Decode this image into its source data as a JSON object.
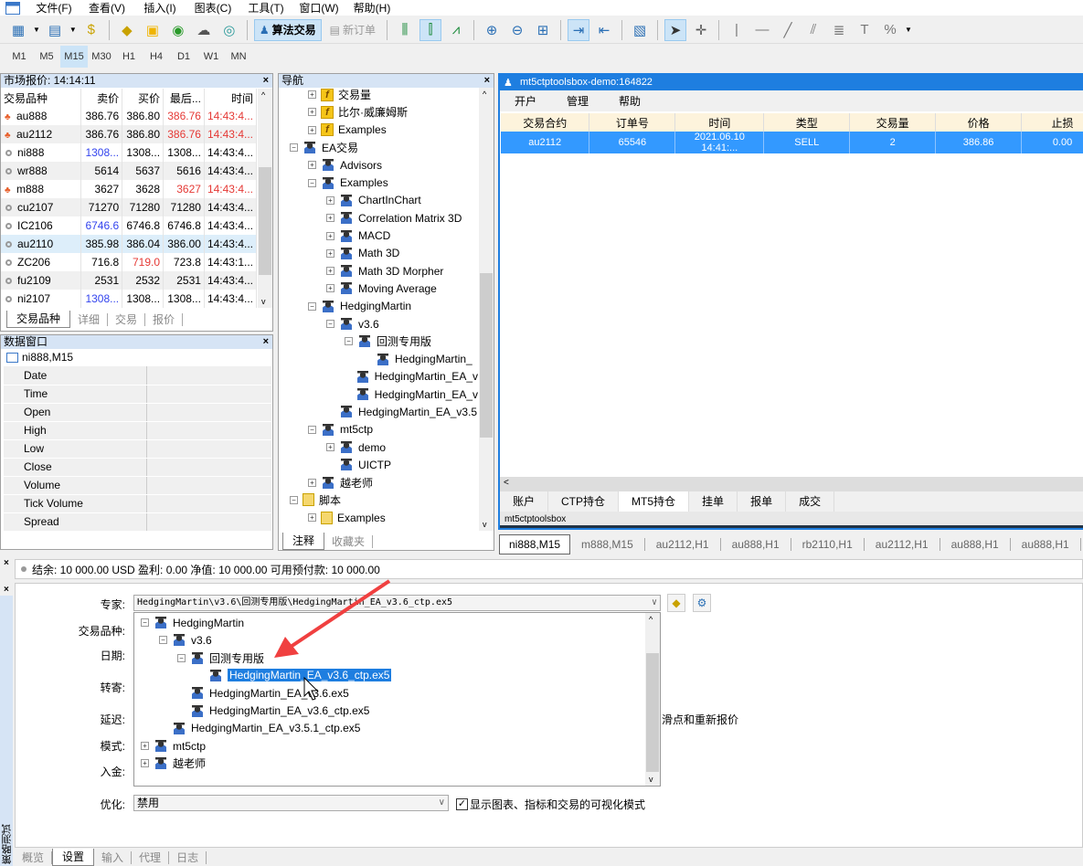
{
  "menu": [
    "文件(F)",
    "查看(V)",
    "插入(I)",
    "图表(C)",
    "工具(T)",
    "窗口(W)",
    "帮助(H)"
  ],
  "toolbar": {
    "algo_trading": "算法交易",
    "new_order": "新订单"
  },
  "timeframes": [
    "M1",
    "M5",
    "M15",
    "M30",
    "H1",
    "H4",
    "D1",
    "W1",
    "MN"
  ],
  "active_timeframe": "M15",
  "market_watch": {
    "title": "市场报价: 14:14:11",
    "columns": [
      "交易品种",
      "卖价",
      "买价",
      "最后...",
      "时间"
    ],
    "rows": [
      {
        "symbol": "au888",
        "bid": "386.76",
        "ask": "386.80",
        "last": "386.76",
        "time": "14:43:4...",
        "icon": "up",
        "last_color": "red"
      },
      {
        "symbol": "au2112",
        "bid": "386.76",
        "ask": "386.80",
        "last": "386.76",
        "time": "14:43:4...",
        "icon": "up",
        "last_color": "red"
      },
      {
        "symbol": "ni888",
        "bid": "1308...",
        "ask": "1308...",
        "last": "1308...",
        "time": "14:43:4...",
        "icon": "dot",
        "bid_color": "blue"
      },
      {
        "symbol": "wr888",
        "bid": "5614",
        "ask": "5637",
        "last": "5616",
        "time": "14:43:4...",
        "icon": "dot"
      },
      {
        "symbol": "m888",
        "bid": "3627",
        "ask": "3628",
        "last": "3627",
        "time": "14:43:4...",
        "icon": "up",
        "last_color": "red"
      },
      {
        "symbol": "cu2107",
        "bid": "71270",
        "ask": "71280",
        "last": "71280",
        "time": "14:43:4...",
        "icon": "dot"
      },
      {
        "symbol": "IC2106",
        "bid": "6746.6",
        "ask": "6746.8",
        "last": "6746.8",
        "time": "14:43:4...",
        "icon": "dot",
        "bid_color": "blue"
      },
      {
        "symbol": "au2110",
        "bid": "385.98",
        "ask": "386.04",
        "last": "386.00",
        "time": "14:43:4...",
        "icon": "dot",
        "selected": true
      },
      {
        "symbol": "ZC206",
        "bid": "716.8",
        "ask": "719.0",
        "last": "723.8",
        "time": "14:43:1...",
        "icon": "dot",
        "ask_color": "red"
      },
      {
        "symbol": "fu2109",
        "bid": "2531",
        "ask": "2532",
        "last": "2531",
        "time": "14:43:4...",
        "icon": "dot"
      },
      {
        "symbol": "ni2107",
        "bid": "1308...",
        "ask": "1308...",
        "last": "1308...",
        "time": "14:43:4...",
        "icon": "dot",
        "bid_color": "blue"
      }
    ],
    "tabs": [
      "交易品种",
      "详细",
      "交易",
      "报价"
    ]
  },
  "data_window": {
    "title": "数据窗口",
    "symbol": "ni888,M15",
    "fields": [
      "Date",
      "Time",
      "Open",
      "High",
      "Low",
      "Close",
      "Volume",
      "Tick Volume",
      "Spread"
    ]
  },
  "navigator": {
    "title": "导航",
    "items": [
      {
        "label": "交易量",
        "level": 2,
        "icon": "indicator",
        "exp": "+"
      },
      {
        "label": "比尔·威廉姆斯",
        "level": 2,
        "icon": "indicator",
        "exp": "+"
      },
      {
        "label": "Examples",
        "level": 2,
        "icon": "indicator-folder",
        "exp": "+"
      },
      {
        "label": "EA交易",
        "level": 1,
        "icon": "ea",
        "exp": "-"
      },
      {
        "label": "Advisors",
        "level": 2,
        "icon": "ea",
        "exp": "+"
      },
      {
        "label": "Examples",
        "level": 2,
        "icon": "ea",
        "exp": "-"
      },
      {
        "label": "ChartInChart",
        "level": 3,
        "icon": "ea",
        "exp": "+"
      },
      {
        "label": "Correlation Matrix 3D",
        "level": 3,
        "icon": "ea",
        "exp": "+"
      },
      {
        "label": "MACD",
        "level": 3,
        "icon": "ea",
        "exp": "+"
      },
      {
        "label": "Math 3D",
        "level": 3,
        "icon": "ea",
        "exp": "+"
      },
      {
        "label": "Math 3D Morpher",
        "level": 3,
        "icon": "ea",
        "exp": "+"
      },
      {
        "label": "Moving Average",
        "level": 3,
        "icon": "ea",
        "exp": "+"
      },
      {
        "label": "HedgingMartin",
        "level": 2,
        "icon": "ea",
        "exp": "-"
      },
      {
        "label": "v3.6",
        "level": 3,
        "icon": "ea",
        "exp": "-"
      },
      {
        "label": "回测专用版",
        "level": 4,
        "icon": "ea",
        "exp": "-"
      },
      {
        "label": "HedgingMartin_",
        "level": 5,
        "icon": "ea",
        "exp": ""
      },
      {
        "label": "HedgingMartin_EA_v",
        "level": 4,
        "icon": "ea",
        "exp": ""
      },
      {
        "label": "HedgingMartin_EA_v",
        "level": 4,
        "icon": "ea",
        "exp": ""
      },
      {
        "label": "HedgingMartin_EA_v3.5",
        "level": 3,
        "icon": "ea",
        "exp": ""
      },
      {
        "label": "mt5ctp",
        "level": 2,
        "icon": "ea",
        "exp": "-"
      },
      {
        "label": "demo",
        "level": 3,
        "icon": "ea",
        "exp": "+"
      },
      {
        "label": "UICTP",
        "level": 3,
        "icon": "ea",
        "exp": ""
      },
      {
        "label": "越老师",
        "level": 2,
        "icon": "ea",
        "exp": "+"
      },
      {
        "label": "脚本",
        "level": 1,
        "icon": "script",
        "exp": "-"
      },
      {
        "label": "Examples",
        "level": 2,
        "icon": "script",
        "exp": "+"
      }
    ],
    "tabs": [
      "注释",
      "收藏夹"
    ]
  },
  "terminal": {
    "title": "mt5ctptoolsbox-demo:164822",
    "menu": [
      "开户",
      "管理",
      "帮助"
    ],
    "columns": [
      "交易合约",
      "订单号",
      "时间",
      "类型",
      "交易量",
      "价格",
      "止损"
    ],
    "rows": [
      [
        "au2112",
        "65546",
        "2021.06.10 14:41:...",
        "SELL",
        "2",
        "386.86",
        "0.00"
      ]
    ],
    "tabs": [
      "账户",
      "CTP持仓",
      "MT5持仓",
      "挂单",
      "报单",
      "成交"
    ],
    "active_tab": "MT5持仓",
    "status": "mt5ctptoolsbox"
  },
  "chart_tabs": [
    "ni888,M15",
    "m888,M15",
    "au2112,H1",
    "au888,H1",
    "rb2110,H1",
    "au2112,H1",
    "au888,H1",
    "au888,H1"
  ],
  "account_bar": "结余: 10 000.00 USD  盈利: 0.00  净值: 10 000.00  可用预付款: 10 000.00",
  "tester": {
    "side_title": "策略测试",
    "labels": {
      "expert": "专家:",
      "symbol": "交易品种:",
      "date": "日期:",
      "forward": "转寄:",
      "delay": "延迟:",
      "mode": "模式:",
      "deposit": "入金:",
      "optimization": "优化:"
    },
    "expert_value": "HedgingMartin\\v3.6\\回测专用版\\HedgingMartin_EA_v3.6_ctp.ex5",
    "tree": [
      {
        "label": "HedgingMartin",
        "level": 0,
        "exp": "-"
      },
      {
        "label": "v3.6",
        "level": 1,
        "exp": "-"
      },
      {
        "label": "回测专用版",
        "level": 2,
        "exp": "-"
      },
      {
        "label": "HedgingMartin_EA_v3.6_ctp.ex5",
        "level": 3,
        "exp": "",
        "selected": true
      },
      {
        "label": "HedgingMartin_EA_v3.6.ex5",
        "level": 2,
        "exp": ""
      },
      {
        "label": "HedgingMartin_EA_v3.6_ctp.ex5",
        "level": 2,
        "exp": ""
      },
      {
        "label": "HedgingMartin_EA_v3.5.1_ctp.ex5",
        "level": 1,
        "exp": ""
      },
      {
        "label": "mt5ctp",
        "level": 0,
        "exp": "+"
      },
      {
        "label": "越老师",
        "level": 0,
        "exp": "+"
      }
    ],
    "delay_suffix": "滑点和重新报价",
    "optimization_value": "禁用",
    "visual_checkbox": {
      "label": "显示图表、指标和交易的可视化模式",
      "checked": true
    },
    "tabs": [
      "概览",
      "设置",
      "输入",
      "代理",
      "日志"
    ],
    "active_tab": "设置"
  },
  "colors": {
    "accent": "#1e7ee0",
    "selection": "#3399ff",
    "header": "#fdf3dc",
    "up": "#e53935",
    "down": "#3344ee",
    "arrow": "#f04040"
  }
}
